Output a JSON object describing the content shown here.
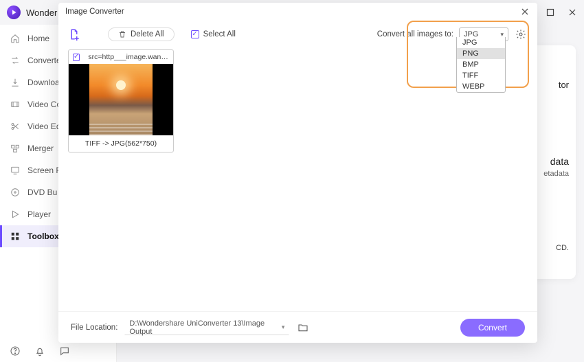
{
  "app": {
    "title": "Wonder"
  },
  "sidebar": {
    "items": [
      {
        "label": "Home"
      },
      {
        "label": "Converte"
      },
      {
        "label": "Downloa"
      },
      {
        "label": "Video Co"
      },
      {
        "label": "Video Ed"
      },
      {
        "label": "Merger"
      },
      {
        "label": "Screen R"
      },
      {
        "label": "DVD Bu"
      },
      {
        "label": "Player"
      },
      {
        "label": "Toolbox"
      }
    ]
  },
  "bg_card": {
    "line1": "tor",
    "line2": "data",
    "line3": "etadata",
    "line4": "CD."
  },
  "modal": {
    "title": "Image Converter",
    "delete_all": "Delete All",
    "select_all": "Select All",
    "convert_target_label": "Convert all images to:",
    "format_selected": "JPG",
    "format_options": [
      "JPG",
      "PNG",
      "BMP",
      "TIFF",
      "WEBP"
    ],
    "format_highlight": "PNG",
    "thumb": {
      "filename": "src=http___image.wangc...",
      "footer": "TIFF -> JPG(562*750)"
    },
    "file_location_label": "File Location:",
    "file_location_path": "D:\\Wondershare UniConverter 13\\Image Output",
    "convert_btn": "Convert"
  }
}
